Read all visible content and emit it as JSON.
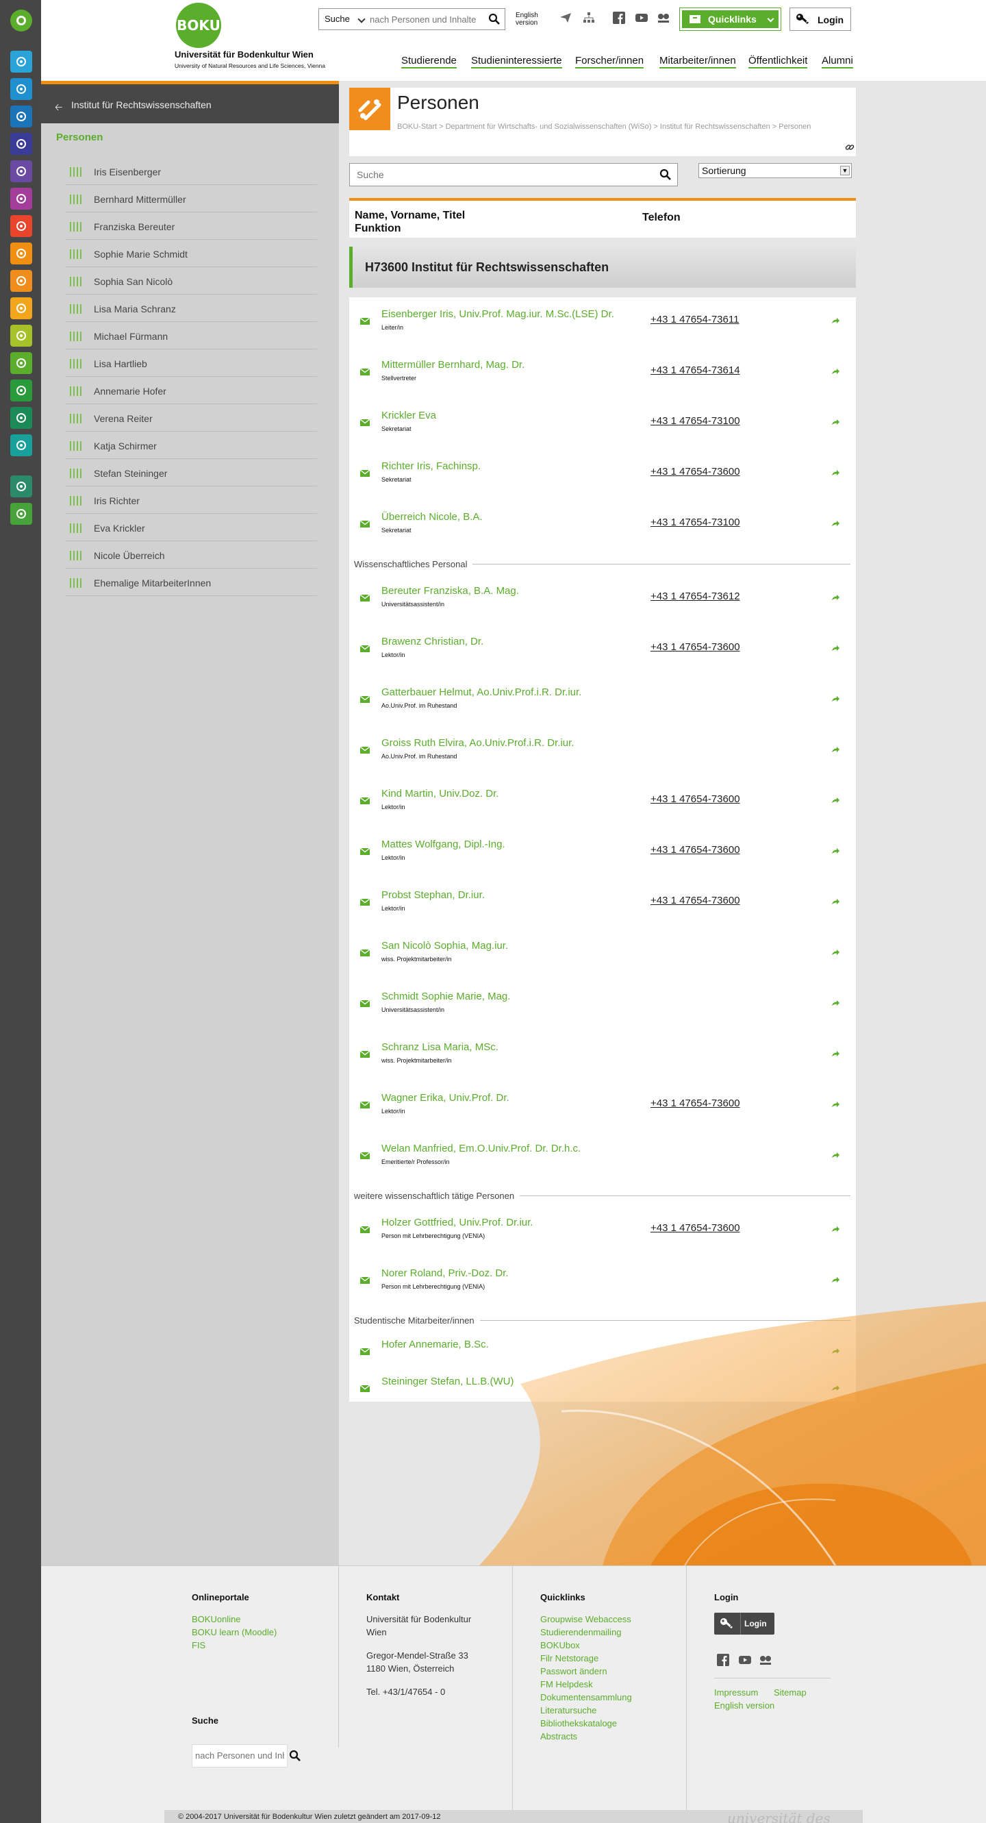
{
  "brand": {
    "logo_text": "BOKU",
    "name": "Universität für Bodenkultur Wien",
    "subtitle": "University of Natural Resources and Life Sciences, Vienna"
  },
  "topbar": {
    "search_select": "Suche",
    "search_placeholder": "nach Personen und Inhalte",
    "english_line1": "English",
    "english_line2": "version",
    "quicklinks_label": "Quicklinks",
    "login_label": "Login"
  },
  "mainnav": [
    "Studierende",
    "Studieninteressierte",
    "Forscher/innen",
    "Mitarbeiter/innen",
    "Öffentlichkeit",
    "Alumni"
  ],
  "rail_colors": [
    "#2aa3d8",
    "#1f8fcf",
    "#1b73b8",
    "#3a3a97",
    "#6b4aa3",
    "#a43c9b",
    "#e8452c",
    "#f18f13",
    "#f08d1c",
    "#f3a51c",
    "#a7c129",
    "#5bad2c",
    "#2a9b3a",
    "#1a8a57",
    "#18a09a",
    "#2b8a6a",
    "#46a33a"
  ],
  "sidebar": {
    "back_label": "Institut für Rechtswissenschaften",
    "title": "Personen",
    "items": [
      "Iris Eisenberger",
      "Bernhard Mittermüller",
      "Franziska Bereuter",
      "Sophie Marie Schmidt",
      "Sophia San Nicolò",
      "Lisa Maria Schranz",
      "Michael Fürmann",
      "Lisa Hartlieb",
      "Annemarie Hofer",
      "Verena Reiter",
      "Katja Schirmer",
      "Stefan Steininger",
      "Iris Richter",
      "Eva Krickler",
      "Nicole Überreich",
      "Ehemalige MitarbeiterInnen"
    ]
  },
  "page": {
    "title": "Personen",
    "breadcrumb": "BOKU-Start > Department für Wirtschafts- und Sozialwissenschaften (WiSo) > Institut für Rechtswissenschaften > Personen",
    "search_placeholder": "Suche",
    "sort_label": "Sortierung",
    "col_name_line1": "Name, Vorname, Titel",
    "col_name_line2": "Funktion",
    "col_phone": "Telefon",
    "group_title": "H73600 Institut für Rechtswissenschaften"
  },
  "people": [
    {
      "name": "Eisenberger Iris, Univ.Prof. Mag.iur. M.Sc.(LSE) Dr.",
      "function": "Leiter/in",
      "phone": "+43 1 47654-73611"
    },
    {
      "name": "Mittermüller Bernhard, Mag. Dr.",
      "function": "Stellvertreter",
      "phone": "+43 1 47654-73614"
    },
    {
      "name": "Krickler Eva",
      "function": "Sekretariat",
      "phone": "+43 1 47654-73100"
    },
    {
      "name": "Richter Iris, Fachinsp.",
      "function": "Sekretariat",
      "phone": "+43 1 47654-73600"
    },
    {
      "name": "Überreich Nicole, B.A.",
      "function": "Sekretariat",
      "phone": "+43 1 47654-73100"
    },
    {
      "section": "Wissenschaftliches Personal"
    },
    {
      "name": "Bereuter Franziska, B.A. Mag.",
      "function": "Universitätsassistent/in",
      "phone": "+43 1 47654-73612"
    },
    {
      "name": "Brawenz Christian, Dr.",
      "function": "Lektor/in",
      "phone": "+43 1 47654-73600"
    },
    {
      "name": "Gatterbauer Helmut, Ao.Univ.Prof.i.R. Dr.iur.",
      "function": "Ao.Univ.Prof. im Ruhestand",
      "phone": ""
    },
    {
      "name": "Groiss Ruth Elvira, Ao.Univ.Prof.i.R. Dr.iur.",
      "function": "Ao.Univ.Prof. im Ruhestand",
      "phone": ""
    },
    {
      "name": "Kind Martin, Univ.Doz. Dr.",
      "function": "Lektor/in",
      "phone": "+43 1 47654-73600"
    },
    {
      "name": "Mattes Wolfgang, Dipl.-Ing.",
      "function": "Lektor/in",
      "phone": "+43 1 47654-73600"
    },
    {
      "name": "Probst Stephan, Dr.iur.",
      "function": "Lektor/in",
      "phone": "+43 1 47654-73600"
    },
    {
      "name": "San Nicolò Sophia, Mag.iur.",
      "function": "wiss. Projektmitarbeiter/in",
      "phone": ""
    },
    {
      "name": "Schmidt Sophie Marie, Mag.",
      "function": "Universitätsassistent/in",
      "phone": ""
    },
    {
      "name": "Schranz Lisa Maria, MSc.",
      "function": "wiss. Projektmitarbeiter/in",
      "phone": ""
    },
    {
      "name": "Wagner Erika, Univ.Prof. Dr.",
      "function": "Lektor/in",
      "phone": "+43 1 47654-73600"
    },
    {
      "name": "Welan Manfried, Em.O.Univ.Prof. Dr. Dr.h.c.",
      "function": "Emeritierte/r Professor/in",
      "phone": ""
    },
    {
      "section": "weitere wissenschaftlich tätige Personen"
    },
    {
      "name": "Holzer Gottfried, Univ.Prof. Dr.iur.",
      "function": "Person mit Lehrberechtigung (VENIA)",
      "phone": "+43 1 47654-73600"
    },
    {
      "name": "Norer Roland, Priv.-Doz. Dr.",
      "function": "Person mit Lehrberechtigung (VENIA)",
      "phone": ""
    },
    {
      "section": "Studentische Mitarbeiter/innen"
    },
    {
      "name": "Hofer Annemarie, B.Sc.",
      "function": "",
      "phone": ""
    },
    {
      "name": "Steininger Stefan, LL.B.(WU)",
      "function": "",
      "phone": ""
    }
  ],
  "footer": {
    "portals_title": "Onlineportale",
    "portals": [
      "BOKUonline",
      "BOKU learn (Moodle)",
      "FIS"
    ],
    "search_title": "Suche",
    "search_placeholder": "nach Personen und Inhalte",
    "contact_title": "Kontakt",
    "contact_name_1": "Universität für Bodenkultur",
    "contact_name_2": "Wien",
    "contact_street": "Gregor-Mendel-Straße 33",
    "contact_city": "1180 Wien, Österreich",
    "contact_tel": "Tel. +43/1/47654 - 0",
    "quicklinks_title": "Quicklinks",
    "quicklinks": [
      "Groupwise Webaccess",
      "Studierendenmailing",
      "BOKUbox",
      "Filr Netstorage",
      "Passwort ändern",
      "FM Helpdesk",
      "Dokumentensammlung",
      "Literatursuche",
      "Bibliothekskataloge",
      "Abstracts"
    ],
    "login_title": "Login",
    "login_button": "Login",
    "links": [
      "Impressum",
      "Sitemap",
      "English version"
    ],
    "copyright": "© 2004-2017 Universität für Bodenkultur Wien zuletzt geändert am 2017-09-12",
    "tagline": "universität des lebens"
  }
}
